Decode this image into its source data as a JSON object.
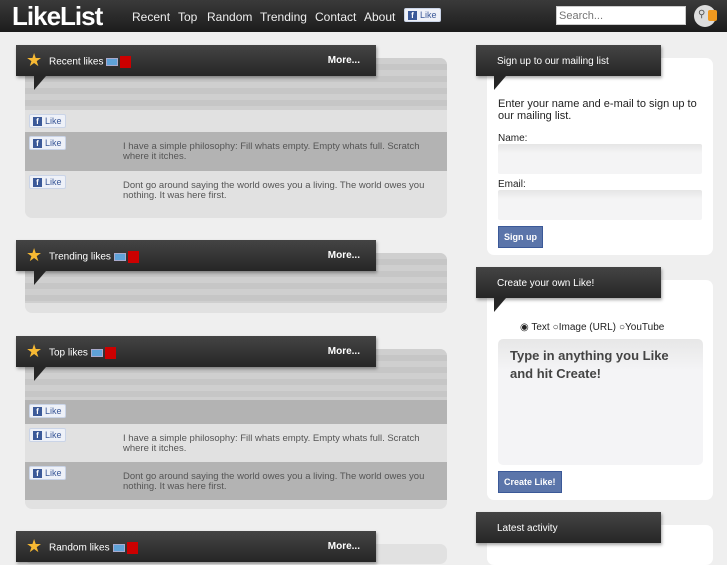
{
  "nav": {
    "logo": "LikeList",
    "links": [
      "Recent",
      "Top",
      "Random",
      "Trending",
      "Contact",
      "About"
    ],
    "fb_like": "Like",
    "search_placeholder": "Search..."
  },
  "sections": [
    {
      "title": "Recent likes",
      "more": "More...",
      "rows": [
        {
          "like": "Like",
          "text": ""
        },
        {
          "like": "Like",
          "text": "I have a simple philosophy: Fill whats empty. Empty whats full. Scratch where it itches."
        },
        {
          "like": "Like",
          "text": "Dont go around saying the world owes you a living. The world owes you nothing. It was here first."
        }
      ]
    },
    {
      "title": "Trending likes",
      "more": "More...",
      "rows": []
    },
    {
      "title": "Top likes",
      "more": "More...",
      "rows": [
        {
          "like": "Like",
          "text": ""
        },
        {
          "like": "Like",
          "text": "I have a simple philosophy: Fill whats empty. Empty whats full. Scratch where it itches."
        },
        {
          "like": "Like",
          "text": "Dont go around saying the world owes you a living. The world owes you nothing. It was here first."
        }
      ]
    },
    {
      "title": "Random likes",
      "more": "More..."
    }
  ],
  "signup": {
    "title": "Sign up to our mailing list",
    "intro": "Enter your name and e-mail to sign up to our mailing list.",
    "name_label": "Name:",
    "email_label": "Email:",
    "button": "Sign up"
  },
  "create": {
    "title": "Create your own Like!",
    "options": [
      "Text",
      "Image (URL)",
      "YouTube"
    ],
    "selected": "Text",
    "textarea": "Type in anything you Like and hit Create!",
    "button": "Create Like!"
  },
  "latest": {
    "title": "Latest activity"
  }
}
